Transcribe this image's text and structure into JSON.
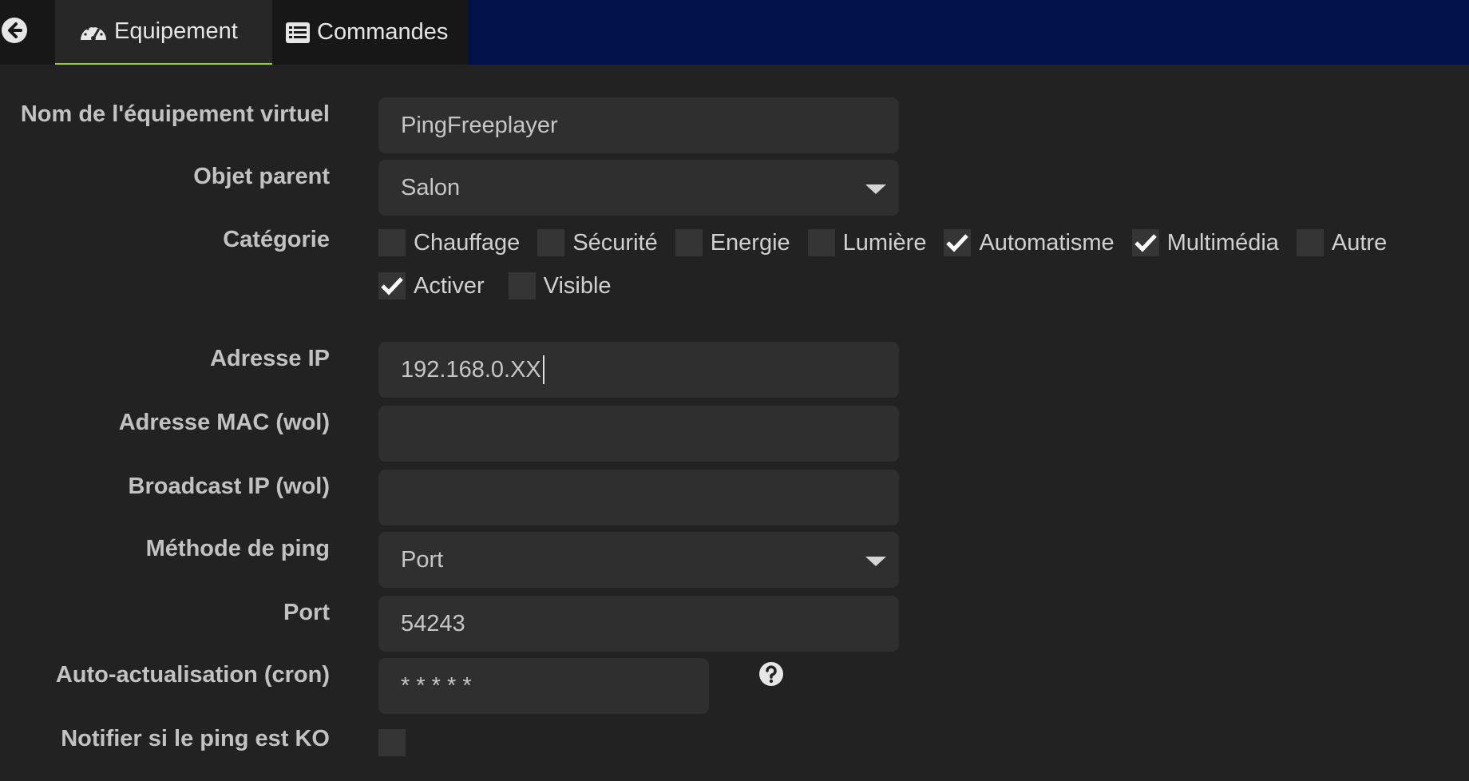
{
  "tabs": {
    "equipement": "Equipement",
    "commandes": "Commandes"
  },
  "form": {
    "name": {
      "label": "Nom de l'équipement virtuel",
      "value": "PingFreeplayer"
    },
    "parent": {
      "label": "Objet parent",
      "value": "Salon"
    },
    "category": {
      "label": "Catégorie",
      "options": [
        {
          "label": "Chauffage",
          "checked": false
        },
        {
          "label": "Sécurité",
          "checked": false
        },
        {
          "label": "Energie",
          "checked": false
        },
        {
          "label": "Lumière",
          "checked": false
        },
        {
          "label": "Automatisme",
          "checked": true
        },
        {
          "label": "Multimédia",
          "checked": true
        },
        {
          "label": "Autre",
          "checked": false
        }
      ]
    },
    "activate": {
      "label": "Activer",
      "checked": true
    },
    "visible": {
      "label": "Visible",
      "checked": false
    },
    "ip": {
      "label": "Adresse IP",
      "value": "192.168.0.XX"
    },
    "mac": {
      "label": "Adresse MAC (wol)",
      "value": ""
    },
    "broadcast": {
      "label": "Broadcast IP (wol)",
      "value": ""
    },
    "method": {
      "label": "Méthode de ping",
      "value": "Port"
    },
    "port": {
      "label": "Port",
      "value": "54243"
    },
    "cron": {
      "label": "Auto-actualisation (cron)",
      "value": "* * * * *"
    },
    "notify": {
      "label": "Notifier si le ping est KO",
      "checked": false
    }
  },
  "icons": {
    "back": "arrow-circle-left-icon",
    "equipement": "tachometer-icon",
    "commandes": "list-alt-icon",
    "help": "question-circle-icon",
    "check": "check-icon"
  },
  "colors": {
    "topbar": "#02124a",
    "background": "#222222",
    "field": "#2f2f2f",
    "active_tab_underline": "#9acd32"
  }
}
